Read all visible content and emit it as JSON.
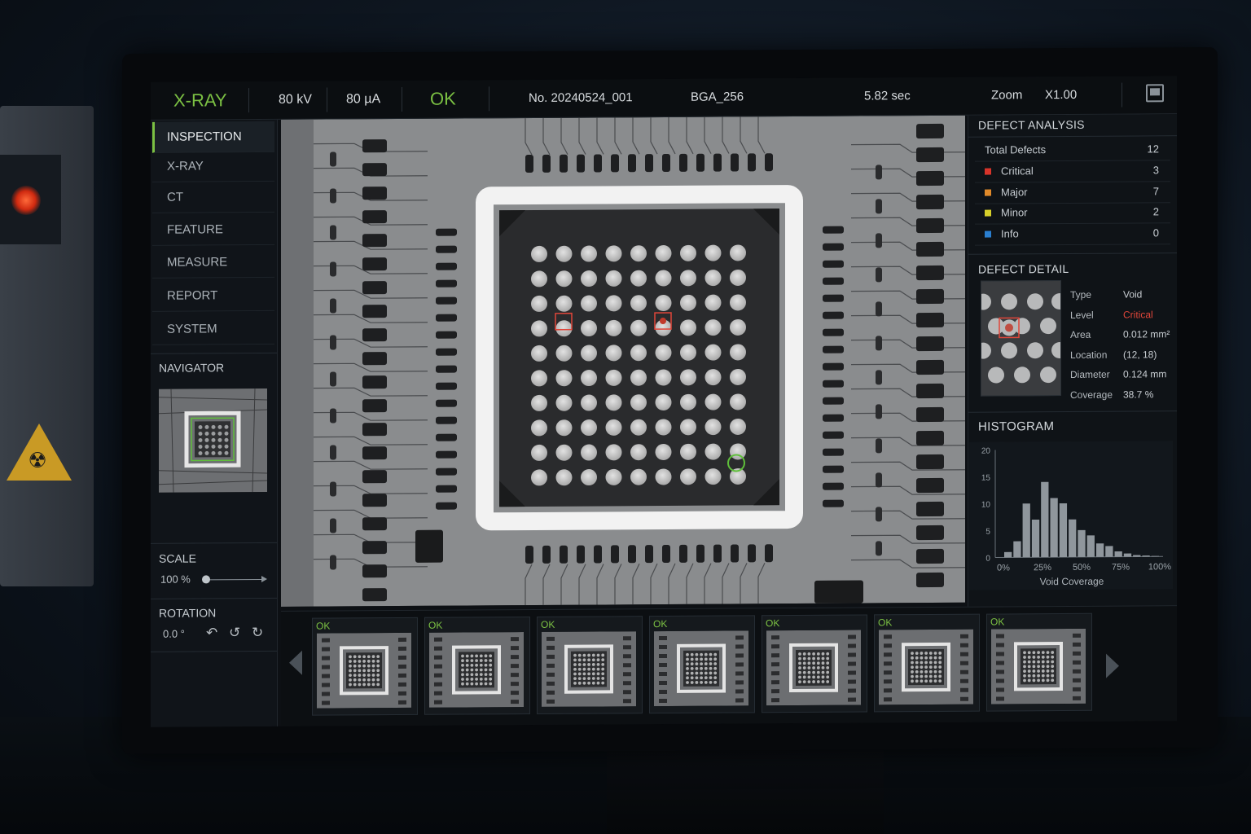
{
  "topbar": {
    "mode": "X-RAY",
    "voltage": "80 kV",
    "current": "80 µA",
    "status": "OK",
    "serial": "No. 20240524_001",
    "package": "BGA_256",
    "time": "5.82 sec",
    "zoom_label": "Zoom",
    "zoom_value": "X1.00"
  },
  "sidebar": {
    "items": [
      {
        "label": "INSPECTION",
        "active": true
      },
      {
        "label": "X-RAY"
      },
      {
        "label": "CT"
      },
      {
        "label": "FEATURE"
      },
      {
        "label": "MEASURE"
      },
      {
        "label": "REPORT"
      },
      {
        "label": "SYSTEM"
      }
    ],
    "navigator_title": "NAVIGATOR",
    "scale_title": "SCALE",
    "scale_value": "100 %",
    "rotation_title": "ROTATION",
    "rotation_value": "0.0 °"
  },
  "defect_analysis": {
    "title": "DEFECT ANALYSIS",
    "total_label": "Total Defects",
    "total_count": "12",
    "rows": [
      {
        "label": "Critical",
        "count": "3",
        "color": "#d8342a"
      },
      {
        "label": "Major",
        "count": "7",
        "color": "#e08a2a"
      },
      {
        "label": "Minor",
        "count": "2",
        "color": "#d6cf2a"
      },
      {
        "label": "Info",
        "count": "0",
        "color": "#2a7fd0"
      }
    ]
  },
  "defect_detail": {
    "title": "DEFECT DETAIL",
    "fields": [
      {
        "key": "Type",
        "value": "Void"
      },
      {
        "key": "Level",
        "value": "Critical"
      },
      {
        "key": "Area",
        "value": "0.012 mm²"
      },
      {
        "key": "Location",
        "value": "(12, 18)"
      },
      {
        "key": "Diameter",
        "value": "0.124 mm"
      },
      {
        "key": "Coverage",
        "value": "38.7 %"
      }
    ]
  },
  "histogram": {
    "title": "HISTOGRAM",
    "xlabel": "Void Coverage",
    "y_ticks": [
      "20",
      "15",
      "10",
      "5",
      "0"
    ],
    "x_ticks": [
      "0%",
      "25%",
      "50%",
      "75%",
      "100%"
    ]
  },
  "chart_data": {
    "type": "bar",
    "xlabel": "Void Coverage",
    "ylim": [
      0,
      20
    ],
    "x_range_percent": [
      0,
      100
    ],
    "values": [
      1,
      3,
      10,
      7,
      14,
      11,
      10,
      7,
      5,
      4,
      2.5,
      2,
      1,
      0.6,
      0.3,
      0.2,
      0.1
    ]
  },
  "filmstrip": {
    "thumbs": [
      {
        "status": "OK"
      },
      {
        "status": "OK"
      },
      {
        "status": "OK"
      },
      {
        "status": "OK"
      },
      {
        "status": "OK"
      },
      {
        "status": "OK"
      },
      {
        "status": "OK"
      }
    ]
  }
}
